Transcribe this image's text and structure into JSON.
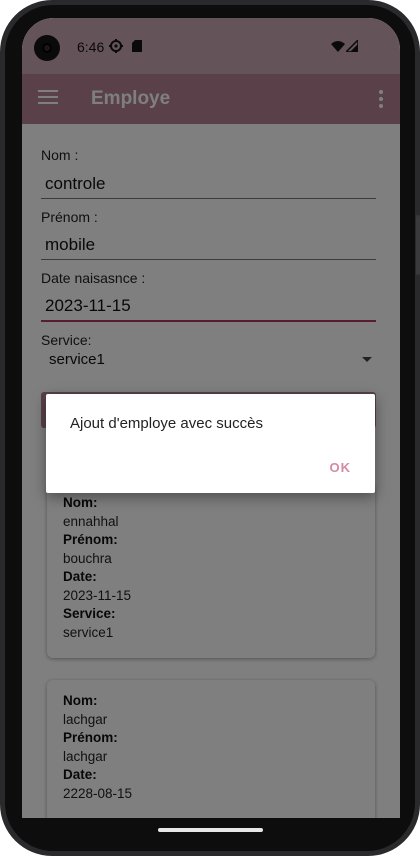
{
  "status_bar": {
    "time": "6:46"
  },
  "app_bar": {
    "title": "Employe"
  },
  "form": {
    "nom_label": "Nom  :",
    "nom_value": "controle",
    "prenom_label": "Prénom  :",
    "prenom_value": "mobile",
    "date_label": "Date naisasnce :",
    "date_value": "2023-11-15",
    "service_label": "Service:",
    "service_value": "service1"
  },
  "employees": [
    {
      "nom_label": "Nom:",
      "nom": "ennahhal",
      "prenom_label": "Prénom:",
      "prenom": "bouchra",
      "date_label": "Date:",
      "date": "2023-11-15",
      "service_label": "Service:",
      "service": "service1"
    },
    {
      "nom_label": "Nom:",
      "nom": "lachgar",
      "prenom_label": "Prénom:",
      "prenom": "lachgar",
      "date_label": "Date:",
      "date": "2228-08-15"
    }
  ],
  "dialog": {
    "message": "Ajout d'employe avec succès",
    "ok_label": "OK"
  },
  "colors": {
    "app_bar": "#b48392",
    "status_bar": "#c9a6b0",
    "accent": "#b03a5e",
    "dialog_button": "#d48aa3"
  }
}
